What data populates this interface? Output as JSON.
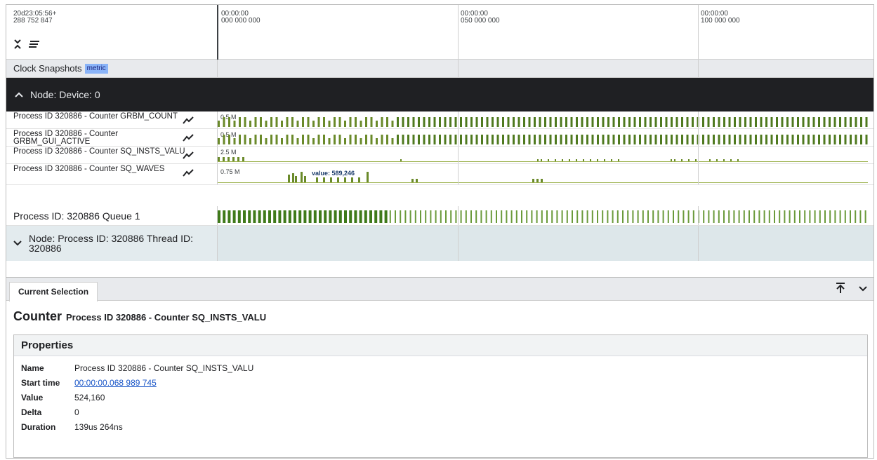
{
  "timeline": {
    "cursor_time_line1": "20d23:05:56+",
    "cursor_time_line2": "288 752 847",
    "ticks": [
      {
        "l1": "00:00:00",
        "l2": "000 000 000"
      },
      {
        "l1": "00:00:00",
        "l2": "050 000 000"
      },
      {
        "l1": "00:00:00",
        "l2": "100 000 000"
      }
    ],
    "icons": [
      "collapse-all-icon",
      "filter-lines-icon"
    ]
  },
  "clock_row": {
    "label": "Clock Snapshots",
    "tag": "metric"
  },
  "node_device": {
    "label": "Node: Device: 0",
    "icon": "chevron-up-icon"
  },
  "counters": [
    {
      "label": "Process ID 320886 - Counter GRBM_COUNT",
      "scale": "0.5 M"
    },
    {
      "label": "Process ID 320886 - Counter GRBM_GUI_ACTIVE",
      "scale": "0.5 M"
    },
    {
      "label": "Process ID 320886 - Counter SQ_INSTS_VALU",
      "scale": "2.5 M"
    },
    {
      "label": "Process ID 320886 - Counter SQ_WAVES",
      "scale": "0.75 M",
      "tooltip": "value: 589,246"
    }
  ],
  "queue_row": {
    "label": "Process ID: 320886 Queue 1"
  },
  "thread_row": {
    "label": "Node: Process ID: 320886 Thread ID: 320886",
    "icon": "chevron-down-icon"
  },
  "panel": {
    "tab": "Current Selection",
    "icons": [
      "pin-top-icon",
      "chevron-down-icon"
    ],
    "selection_type": "Counter",
    "selection_name": "Process ID 320886 - Counter SQ_INSTS_VALU",
    "properties_title": "Properties",
    "properties": [
      {
        "key": "Name",
        "value": "Process ID 320886 - Counter SQ_INSTS_VALU"
      },
      {
        "key": "Start time",
        "value": "00:00:00.068 989 745",
        "link": true
      },
      {
        "key": "Value",
        "value": "524,160"
      },
      {
        "key": "Delta",
        "value": "0"
      },
      {
        "key": "Duration",
        "value": "139us 264ns"
      }
    ]
  },
  "colors": {
    "bar": "#6a8a2a",
    "bar_light": "#9ab04a",
    "node_bg": "#1f2023",
    "thread_bg": "#dde7ea",
    "link": "#1a56c8"
  }
}
